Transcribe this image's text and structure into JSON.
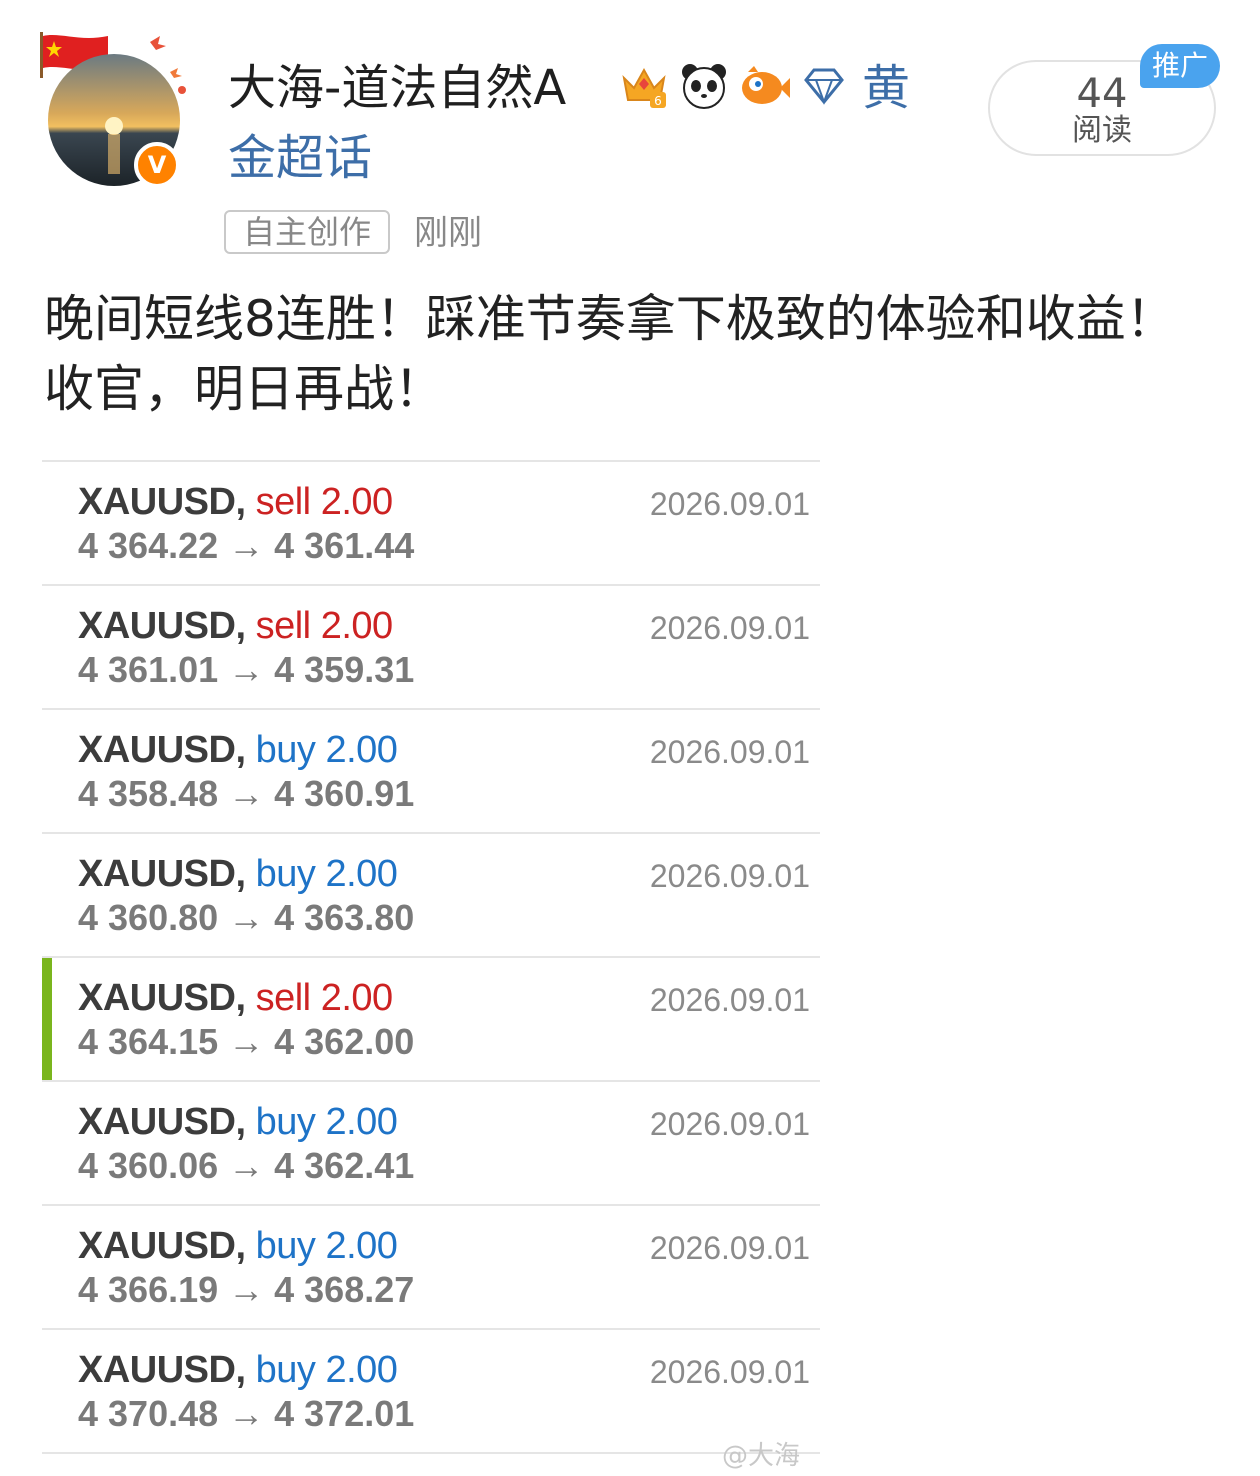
{
  "author": {
    "name": "大海-道法自然A",
    "verified_badge": "V",
    "badges": [
      "crown-level-6-icon",
      "panda-icon",
      "fish-icon",
      "diamond-icon"
    ],
    "accent_color": "#ff8200"
  },
  "topic": {
    "line1": "黄",
    "line2": "金超话"
  },
  "reads": {
    "count": "44",
    "label": "阅读",
    "promo": "推广"
  },
  "meta": {
    "tag": "自主创作",
    "time": "刚刚"
  },
  "post": {
    "text_line1": "晚间短线8连胜！踩准节奏拿下极致的体验和收益！",
    "text_line2": "收官，明日再战！"
  },
  "trades": [
    {
      "symbol": "XAUUSD,",
      "side": "sell",
      "lots": "2.00",
      "open": "4 364.22",
      "close": "4 361.44",
      "date": "2026.09.01",
      "selected": false
    },
    {
      "symbol": "XAUUSD,",
      "side": "sell",
      "lots": "2.00",
      "open": "4 361.01",
      "close": "4 359.31",
      "date": "2026.09.01",
      "selected": false
    },
    {
      "symbol": "XAUUSD,",
      "side": "buy",
      "lots": "2.00",
      "open": "4 358.48",
      "close": "4 360.91",
      "date": "2026.09.01",
      "selected": false
    },
    {
      "symbol": "XAUUSD,",
      "side": "buy",
      "lots": "2.00",
      "open": "4 360.80",
      "close": "4 363.80",
      "date": "2026.09.01",
      "selected": false
    },
    {
      "symbol": "XAUUSD,",
      "side": "sell",
      "lots": "2.00",
      "open": "4 364.15",
      "close": "4 362.00",
      "date": "2026.09.01",
      "selected": true
    },
    {
      "symbol": "XAUUSD,",
      "side": "buy",
      "lots": "2.00",
      "open": "4 360.06",
      "close": "4 362.41",
      "date": "2026.09.01",
      "selected": false
    },
    {
      "symbol": "XAUUSD,",
      "side": "buy",
      "lots": "2.00",
      "open": "4 366.19",
      "close": "4 368.27",
      "date": "2026.09.01",
      "selected": false
    },
    {
      "symbol": "XAUUSD,",
      "side": "buy",
      "lots": "2.00",
      "open": "4 370.48",
      "close": "4 372.01",
      "date": "2026.09.01",
      "selected": false
    }
  ],
  "arrow_glyph": "→",
  "watermark": "@大海"
}
